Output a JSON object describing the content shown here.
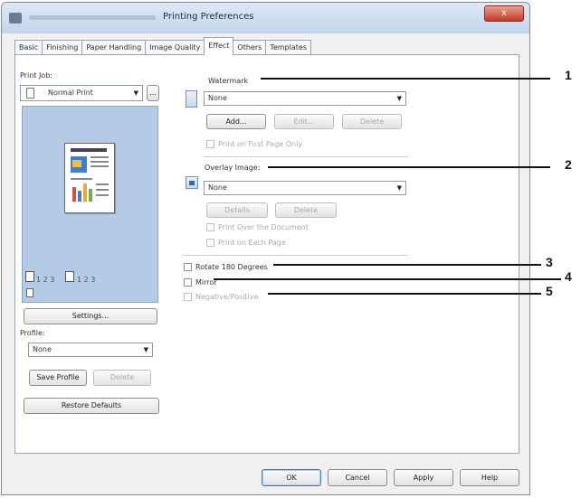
{
  "window": {
    "title": "Printing Preferences",
    "close_glyph": "x"
  },
  "tabs": [
    "Basic",
    "Finishing",
    "Paper Handling",
    "Image Quality",
    "Effect",
    "Others",
    "Templates"
  ],
  "active_tab": "Effect",
  "left": {
    "print_job_label": "Print Job:",
    "print_job_value": "Normal Print",
    "print_job_more": "...",
    "preview_labels": [
      "1 2 3",
      "1 2 3"
    ],
    "settings_button": "Settings...",
    "profile_label": "Profile:",
    "profile_value": "None",
    "save_profile_button": "Save Profile",
    "delete_profile_button": "Delete",
    "restore_defaults_button": "Restore Defaults"
  },
  "watermark": {
    "label": "Watermark",
    "value": "None",
    "add_button": "Add...",
    "edit_button": "Edit...",
    "delete_button": "Delete",
    "first_page_only": "Print on First Page Only"
  },
  "overlay": {
    "label": "Overlay Image:",
    "value": "None",
    "details_button": "Details",
    "delete_button": "Delete",
    "print_over": "Print Over the Document",
    "print_each": "Print on Each Page"
  },
  "options": {
    "rotate": "Rotate 180 Degrees",
    "mirror": "Mirror",
    "negative": "Negative/Positive"
  },
  "bottom_buttons": {
    "ok": "OK",
    "cancel": "Cancel",
    "apply": "Apply",
    "help": "Help"
  },
  "callouts": [
    "1",
    "2",
    "3",
    "4",
    "5"
  ],
  "icons": {
    "title": "printer-icon",
    "print_job": "document-icon",
    "watermark": "watermark-icon",
    "overlay": "overlay-icon",
    "preview_stack": "paper-stack-icon"
  }
}
